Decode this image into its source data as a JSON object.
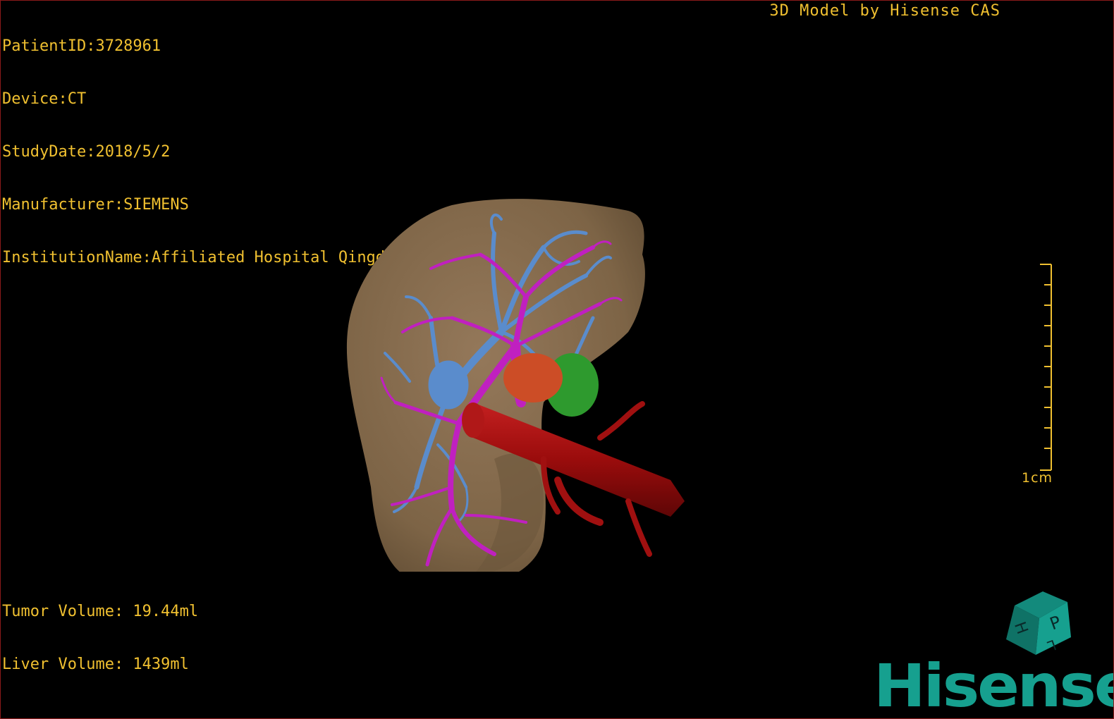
{
  "patient_info": {
    "patient_id": "PatientID:3728961",
    "device": "Device:CT",
    "study_date": "StudyDate:2018/5/2",
    "manufacturer": "Manufacturer:SIEMENS",
    "institution": "InstitutionName:Affiliated Hospital Qingdao University-C"
  },
  "header_credit": "3D Model by Hisense CAS",
  "volumes": {
    "tumor": "Tumor Volume: 19.44ml",
    "liver": "Liver Volume: 1439ml"
  },
  "scale_bar": {
    "label": "1cm",
    "ticks": 10
  },
  "orientation_cube": {
    "faces": [
      "P",
      "H",
      "L"
    ]
  },
  "logo": "Hisense",
  "colors": {
    "overlay_text": "#f0c030",
    "liver": "#8a7050",
    "portal_vein": "#c020c0",
    "hepatic_vein": "#5a8ccc",
    "artery_ivc": "#a01010",
    "tumor": "#d05028",
    "gallbladder": "#30a030",
    "brand": "#16a08f"
  }
}
